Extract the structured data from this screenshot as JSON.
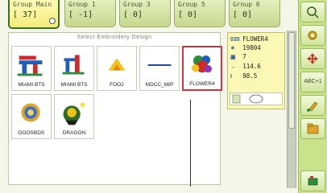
{
  "groups": [
    {
      "title": "Group Main",
      "count": "[ 37]",
      "active": true
    },
    {
      "title": "Group 1",
      "count": "[ -1]",
      "active": false
    },
    {
      "title": "Group 3",
      "count": "[  0]",
      "active": false
    },
    {
      "title": "Group 5",
      "count": "[  0]",
      "active": false
    },
    {
      "title": "Group 6",
      "count": "[  0]",
      "active": false
    }
  ],
  "panel": {
    "title": "Select Embroidery Design",
    "designs": [
      {
        "label": "MIAMI BTS",
        "icon": "miami-bts-design-icon"
      },
      {
        "label": "MIAMI BTS",
        "icon": "miami-bts-design-icon"
      },
      {
        "label": "FOO2",
        "icon": "foo2-design-icon"
      },
      {
        "label": "MDCC_MIP",
        "icon": "mdcc-mip-design-icon"
      },
      {
        "label": "FLOWER4",
        "icon": "flower-design-icon",
        "selected": true
      },
      {
        "label": "DOOSBDS",
        "icon": "doosbds-design-icon"
      },
      {
        "label": "DRAGON",
        "icon": "dragon-design-icon"
      }
    ]
  },
  "info": {
    "number": "035",
    "name": "FLOWER4",
    "stitches": "19804",
    "colors": "7",
    "width": "114.6",
    "height": "98.5"
  },
  "toolbar": {
    "abc_label": "ABC+1"
  },
  "colors": {
    "accent_green": "#c9e38a",
    "tab_active": "#f3ec7c",
    "selection_red": "#d8323a",
    "info_bg": "#fbf7b4"
  }
}
